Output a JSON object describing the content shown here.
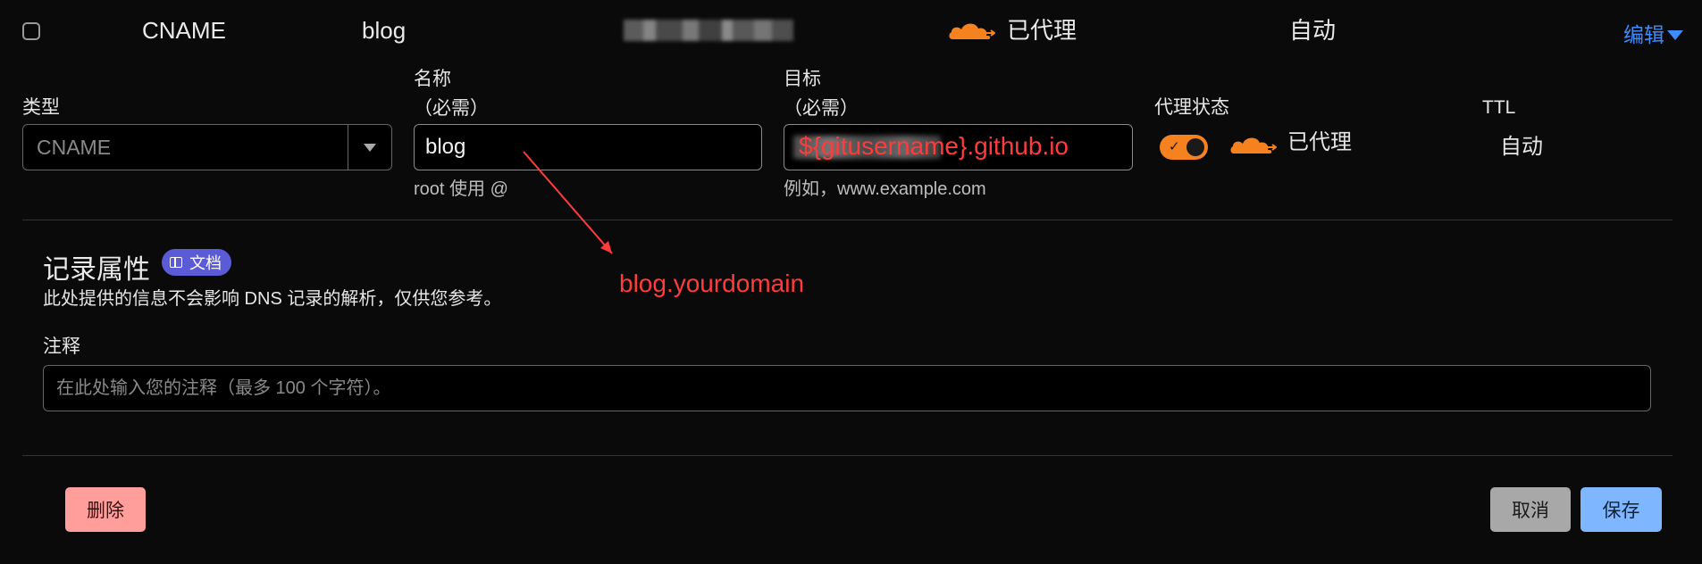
{
  "record_row": {
    "type": "CNAME",
    "name": "blog",
    "content_blurred": true,
    "proxy_status": "已代理",
    "ttl": "自动",
    "edit_label": "编辑"
  },
  "form": {
    "type": {
      "label": "类型",
      "value": "CNAME"
    },
    "name": {
      "label": "名称",
      "required": "（必需）",
      "value": "blog",
      "hint": "root 使用 @"
    },
    "target": {
      "label": "目标",
      "required": "（必需）",
      "overlay_text": "${gitusername}.github.io",
      "hint": "例如，www.example.com"
    },
    "proxy": {
      "label": "代理状态",
      "enabled": true,
      "status": "已代理"
    },
    "ttl": {
      "label": "TTL",
      "value": "自动"
    }
  },
  "record_attributes": {
    "title": "记录属性",
    "docs_badge": "文档",
    "description": "此处提供的信息不会影响 DNS 记录的解析，仅供您参考。",
    "comment_label": "注释",
    "comment_placeholder": "在此处输入您的注释（最多 100 个字符）。"
  },
  "annotation": {
    "text": "blog.yourdomain",
    "color": "#ff3b3b"
  },
  "buttons": {
    "delete": "删除",
    "cancel": "取消",
    "save": "保存"
  },
  "colors": {
    "accent_orange": "#f6821f",
    "link_blue": "#3d8bfd",
    "badge_purple": "#5b5bd6",
    "delete_bg": "#ff9e9b",
    "cancel_bg": "#a8a8a8",
    "save_bg": "#7eb6ff"
  }
}
